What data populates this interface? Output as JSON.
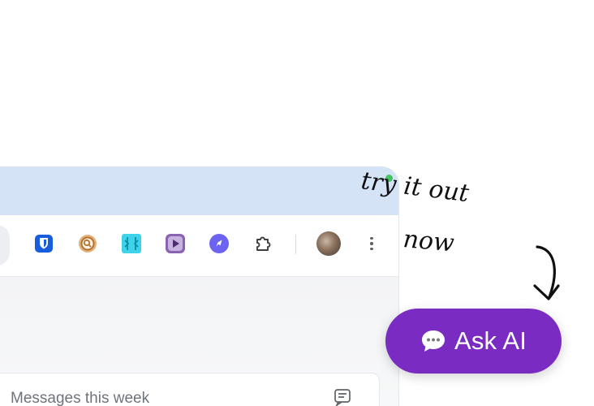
{
  "browser": {
    "extensions": [
      {
        "name": "bitwarden-icon",
        "color": "#175ddc"
      },
      {
        "name": "magnifier-extension-icon",
        "color": "#c1813b"
      },
      {
        "name": "grid-extension-icon",
        "color": "#2fc8e3"
      },
      {
        "name": "video-play-extension-icon",
        "color": "#7a4fa3"
      },
      {
        "name": "rocket-extension-icon",
        "color": "#6c63f0"
      },
      {
        "name": "puzzle-icon",
        "color": "#3c4043"
      }
    ],
    "tabstrip_color": "#d5e3f7"
  },
  "content": {
    "card_title": "Messages this week"
  },
  "annotation": {
    "line1": "try it out",
    "line2": "now"
  },
  "ask_ai": {
    "label": "Ask AI",
    "color": "#7a2bc2"
  }
}
